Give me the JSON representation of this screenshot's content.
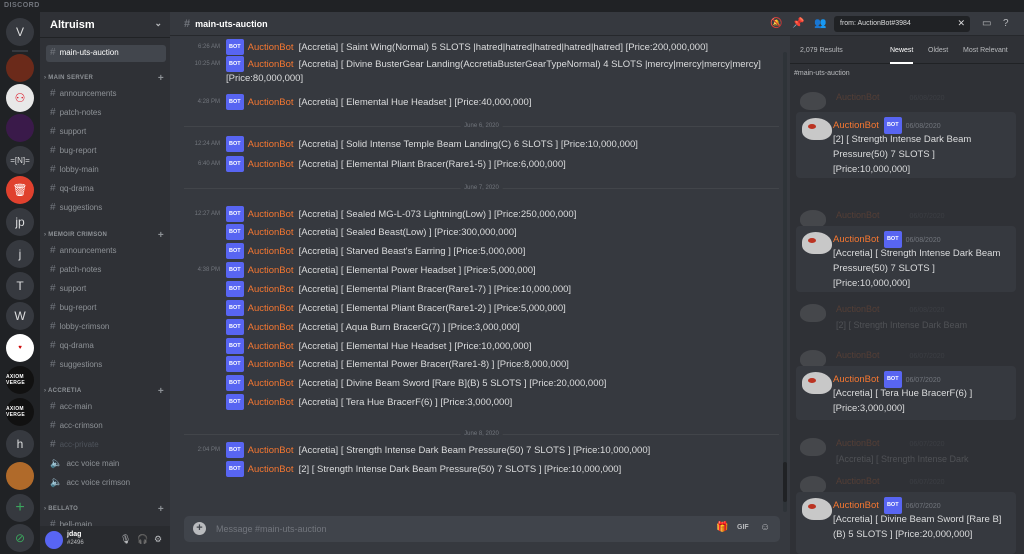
{
  "app": {
    "title": "DISCORD"
  },
  "servers": {
    "items": [
      "V",
      "",
      "",
      "",
      "=[N]=",
      "",
      "jp",
      "j",
      "T",
      "W",
      "",
      "AXIOM VERGE",
      "AXIOM VERGE",
      "h",
      "",
      ""
    ]
  },
  "guild": {
    "name": "Altruism"
  },
  "sidebar": {
    "top_channel": "main-uts-auction",
    "categories": [
      {
        "name": "MAIN SERVER",
        "channels": [
          "announcements",
          "patch-notes",
          "support",
          "bug-report",
          "lobby-main",
          "qq-drama",
          "suggestions"
        ]
      },
      {
        "name": "MEMOIR CRIMSON",
        "channels": [
          "announcements",
          "patch-notes",
          "support",
          "bug-report",
          "lobby-crimson",
          "qq-drama",
          "suggestions"
        ]
      },
      {
        "name": "ACCRETIA",
        "channels": [
          "acc-main",
          "acc-crimson",
          "acc-private",
          "acc voice main",
          "acc voice crimson"
        ]
      },
      {
        "name": "BELLATO",
        "channels": [
          "bell-main"
        ]
      }
    ]
  },
  "user": {
    "name": "jdag",
    "tag": "#2496"
  },
  "header": {
    "channel": "main-uts-auction",
    "search": "from: AuctionBot#3984"
  },
  "bot_label": "BOT",
  "author": "AuctionBot",
  "messages": [
    {
      "time": "6:26 AM",
      "text": "[Accretia] [ Saint Wing(Normal) 5  SLOTS |hatred|hatred|hatred|hatred|hatred] [Price:200,000,000]"
    },
    {
      "time": "10:25 AM",
      "text": "[Accretia] [ Divine BusterGear Landing(AccretiaBusterGearTypeNormal) 4  SLOTS |mercy|mercy|mercy|mercy] [Price:80,000,000]"
    },
    {
      "time": "4:28 PM",
      "text": "[Accretia] [ Elemental Hue Headset   ] [Price:40,000,000]"
    },
    {
      "divider": "June 6, 2020"
    },
    {
      "time": "12:24 AM",
      "text": "[Accretia] [ Solid Intense Temple Beam Landing(C) 6  SLOTS ] [Price:10,000,000]"
    },
    {
      "time": "6:40 AM",
      "text": "[Accretia] [ Elemental Pliant Bracer(Rare1-5)  ] [Price:6,000,000]"
    },
    {
      "divider": "June 7, 2020"
    },
    {
      "time": "12:27 AM",
      "text": "[Accretia] [ Sealed MG-L-073 Lightning(Low)   ] [Price:250,000,000]"
    },
    {
      "time": "",
      "text": "[Accretia] [ Sealed Beast(Low)   ] [Price:300,000,000]"
    },
    {
      "time": "",
      "text": "[Accretia] [ Starved Beast's Earring   ] [Price:5,000,000]"
    },
    {
      "time": "4:38 PM",
      "text": "[Accretia] [ Elemental Power Headset   ] [Price:5,000,000]"
    },
    {
      "time": "",
      "text": "[Accretia] [ Elemental Pliant Bracer(Rare1-7)   ] [Price:10,000,000]"
    },
    {
      "time": "",
      "text": "[Accretia] [ Elemental Pliant Bracer(Rare1-2)   ] [Price:5,000,000]"
    },
    {
      "time": "",
      "text": "[Accretia] [ Aqua Burn BracerG(7)   ] [Price:3,000,000]"
    },
    {
      "time": "",
      "text": "[Accretia] [ Elemental Hue Headset   ] [Price:10,000,000]"
    },
    {
      "time": "",
      "text": "[Accretia] [ Elemental Power Bracer(Rare1-8)   ] [Price:8,000,000]"
    },
    {
      "time": "",
      "text": "[Accretia] [ Divine Beam Sword [Rare B](B) 5  SLOTS ] [Price:20,000,000]"
    },
    {
      "time": "",
      "text": "[Accretia] [ Tera Hue BracerF(6)   ] [Price:3,000,000]"
    },
    {
      "divider": "June 8, 2020"
    },
    {
      "time": "2:04 PM",
      "text": "[Accretia] [ Strength Intense Dark Beam Pressure(50) 7  SLOTS ] [Price:10,000,000]"
    },
    {
      "time": "",
      "text": "[2] [ Strength Intense Dark Beam Pressure(50) 7  SLOTS ] [Price:10,000,000]"
    }
  ],
  "composer": {
    "placeholder": "Message #main-uts-auction"
  },
  "results": {
    "count": "2,079 Results",
    "sort": [
      "Newest",
      "Oldest",
      "Most Relevant"
    ],
    "channel": "#main-uts-auction",
    "ghosts": [
      {
        "date": "06/08/2020",
        "line2": ""
      },
      {
        "date": "06/07/2020",
        "line2": ""
      },
      {
        "date": "06/08/2020",
        "line2": "[2] [ Strength Intense Dark Beam"
      },
      {
        "date": "06/07/2020",
        "line2": ""
      },
      {
        "date": "06/07/2020",
        "line2": "[Accretia] [ Strength Intense Dark"
      },
      {
        "date": "06/07/2020",
        "line2": ""
      }
    ],
    "cards": [
      {
        "date": "06/08/2020",
        "text": "[2] [ Strength Intense Dark Beam Pressure(50) 7  SLOTS ] [Price:10,000,000]"
      },
      {
        "date": "06/08/2020",
        "text": "[Accretia] [ Strength Intense Dark Beam Pressure(50) 7  SLOTS ] [Price:10,000,000]"
      },
      {
        "date": "06/07/2020",
        "text": "[Accretia] [ Tera Hue BracerF(6)   ] [Price:3,000,000]"
      },
      {
        "date": "06/07/2020",
        "text": "[Accretia] [ Divine Beam Sword [Rare B](B) 5  SLOTS ] [Price:20,000,000]"
      }
    ]
  },
  "colors": {
    "accent": "#5865f2",
    "author": "#f57731",
    "bg": "#36393f",
    "sidebar": "#2f3136"
  }
}
